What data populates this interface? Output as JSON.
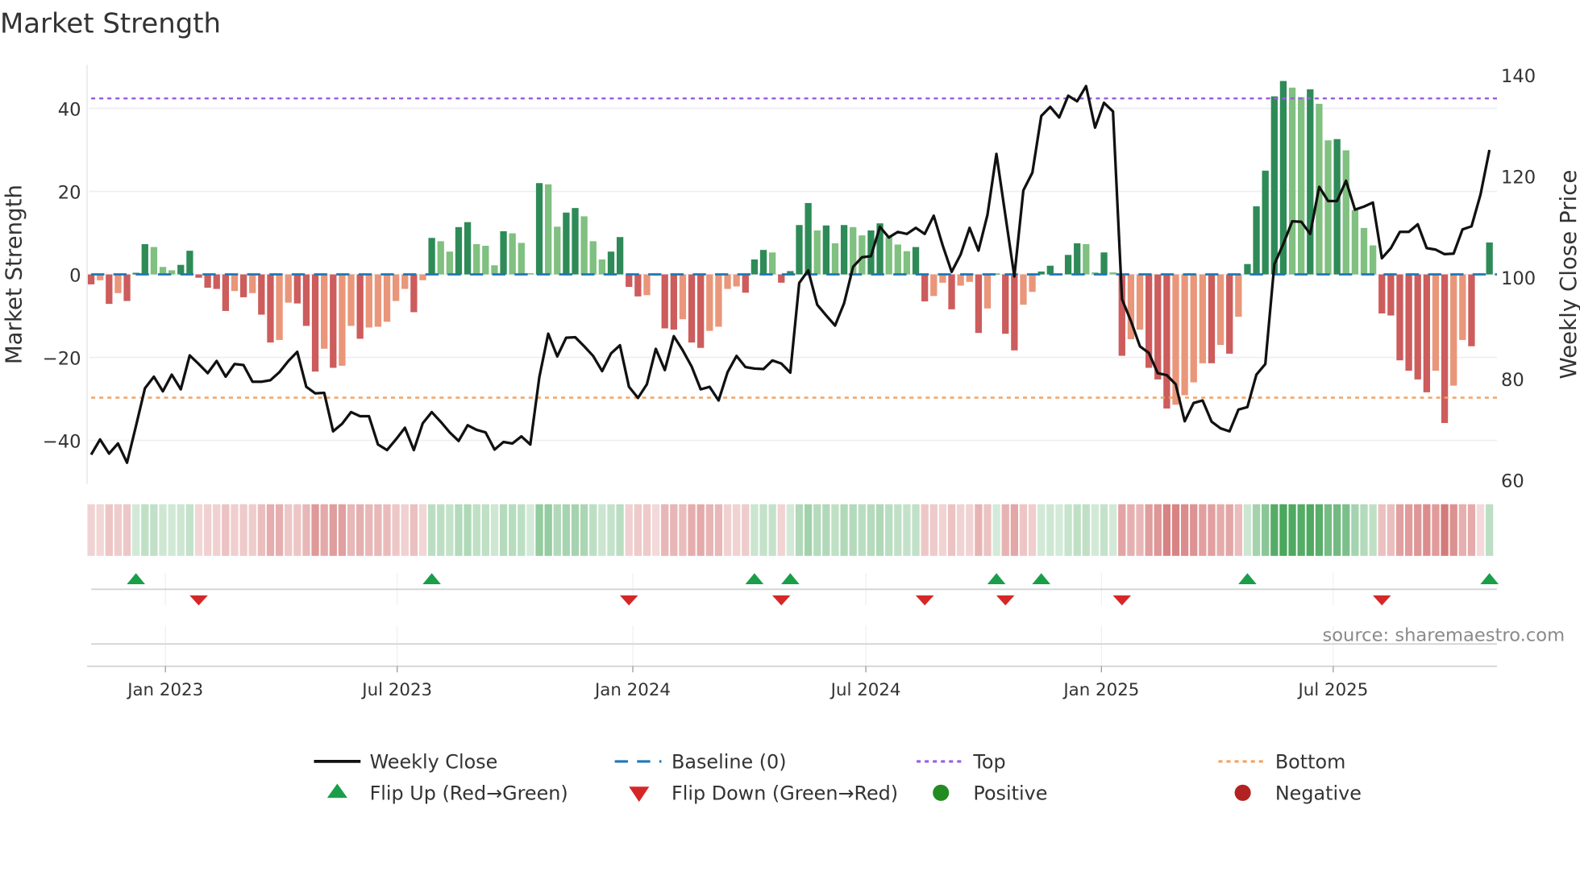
{
  "chart_data": {
    "type": "bar",
    "title": "Market Strength",
    "ylabel": "Market Strength",
    "y2label": "Weekly Close Price",
    "ylim": [
      -50,
      50
    ],
    "y2lim": [
      59.6,
      141.6
    ],
    "yticks": [
      -40,
      -20,
      0,
      20,
      40
    ],
    "ytick_labels": [
      "−40",
      "−20",
      "0",
      "20",
      "40"
    ],
    "y2ticks": [
      60,
      80,
      100,
      120,
      140
    ],
    "y2tick_labels": [
      "60",
      "80",
      "100",
      "120",
      "140"
    ],
    "start_date": "2022-11-04",
    "frequency": "weekly",
    "xticks": [
      {
        "date": "2023-01-01",
        "label": "Jan 2023"
      },
      {
        "date": "2023-07-01",
        "label": "Jul 2023"
      },
      {
        "date": "2024-01-01",
        "label": "Jan 2024"
      },
      {
        "date": "2024-07-01",
        "label": "Jul 2024"
      },
      {
        "date": "2025-01-01",
        "label": "Jan 2025"
      },
      {
        "date": "2025-07-01",
        "label": "Jul 2025"
      }
    ],
    "top_level": 42.4,
    "bottom_level": -29.7,
    "strength": [
      -2.4,
      -1.4,
      -7.1,
      -4.5,
      -6.4,
      0.4,
      7.3,
      6.6,
      1.8,
      1.0,
      2.3,
      5.7,
      -0.8,
      -3.2,
      -3.5,
      -8.8,
      -4.0,
      -5.5,
      -4.5,
      -9.7,
      -16.4,
      -15.8,
      -6.8,
      -7.0,
      -12.4,
      -23.4,
      -17.9,
      -22.5,
      -22.0,
      -12.4,
      -15.5,
      -12.8,
      -12.6,
      -11.4,
      -6.4,
      -3.5,
      -9.1,
      -1.4,
      8.8,
      8.0,
      5.5,
      11.4,
      12.6,
      7.3,
      6.9,
      2.2,
      10.4,
      9.9,
      7.6,
      0.3,
      22.0,
      21.7,
      11.5,
      14.9,
      16.0,
      14.0,
      8.0,
      3.6,
      5.5,
      9.0,
      -3.0,
      -5.3,
      -5.0,
      -0.3,
      -13.0,
      -13.3,
      -10.8,
      -16.4,
      -17.7,
      -13.6,
      -12.6,
      -3.5,
      -2.9,
      -4.4,
      3.6,
      5.9,
      5.3,
      -2.0,
      0.8,
      11.9,
      17.2,
      10.6,
      11.8,
      7.5,
      11.9,
      11.4,
      9.4,
      10.6,
      12.3,
      9.0,
      7.2,
      5.6,
      6.6,
      -6.5,
      -5.2,
      -2.0,
      -8.4,
      -2.7,
      -1.8,
      -14.1,
      -8.2,
      0.2,
      -14.3,
      -18.3,
      -7.3,
      -4.2,
      0.7,
      2.1,
      0.2,
      4.7,
      7.5,
      7.3,
      0.5,
      5.3,
      0.5,
      -19.6,
      -15.6,
      -13.3,
      -22.5,
      -25.3,
      -32.3,
      -31.4,
      -29.1,
      -26.0,
      -21.4,
      -21.4,
      -17.0,
      -19.1,
      -10.2,
      2.5,
      16.4,
      25.0,
      42.9,
      46.6,
      45.0,
      42.7,
      44.6,
      41.1,
      32.3,
      32.6,
      29.9,
      15.5,
      11.2,
      7.0,
      -9.4,
      -9.9,
      -20.7,
      -23.2,
      -25.3,
      -28.4,
      -23.2,
      -35.8,
      -26.8,
      -15.8,
      -17.3,
      -0.2,
      7.7
    ],
    "weekly_close": [
      65,
      68,
      65.2,
      67.2,
      63.4,
      70.7,
      78.1,
      80.4,
      77.5,
      80.8,
      77.9,
      84.6,
      82.9,
      81.1,
      83.5,
      80.4,
      82.9,
      82.7,
      79.4,
      79.4,
      79.7,
      81.3,
      83.5,
      85.3,
      78.4,
      77.1,
      77.2,
      69.6,
      71.1,
      73.4,
      72.6,
      72.6,
      67,
      65.9,
      68,
      70.3,
      65.9,
      71.2,
      73.4,
      71.5,
      69.4,
      67.7,
      70.8,
      69.9,
      69.4,
      66,
      67.5,
      67.2,
      68.6,
      67,
      80.3,
      88.9,
      84.4,
      88.1,
      88.2,
      86.4,
      84.5,
      81.5,
      85,
      86.6,
      78.4,
      76.2,
      78.9,
      85.9,
      81.7,
      88.4,
      85.6,
      82.4,
      77.9,
      78.4,
      75.7,
      81.3,
      84.5,
      82.3,
      82,
      81.9,
      83.6,
      83,
      81.2,
      98.9,
      101.4,
      94.6,
      92.5,
      90.5,
      94.9,
      102.1,
      104,
      104.2,
      110,
      107.9,
      109,
      108.6,
      109.8,
      108.6,
      112.2,
      106.3,
      101.1,
      104.5,
      109.8,
      105.3,
      112.4,
      124.4,
      112.2,
      100.2,
      117.2,
      120.7,
      131.9,
      133.7,
      131.6,
      135.9,
      134.8,
      137.8,
      129.6,
      134.5,
      132.8,
      95.7,
      91.4,
      86.4,
      85.1,
      81.1,
      80.7,
      78.9,
      71.6,
      75.2,
      75.7,
      71.5,
      70.2,
      69.6,
      73.9,
      74.4,
      80.8,
      82.9,
      102.6,
      106.6,
      111.1,
      111,
      108.6,
      117.9,
      115.1,
      115.1,
      119.1,
      113.4,
      114,
      114.8,
      103.8,
      105.8,
      109,
      109,
      110.5,
      105.8,
      105.5,
      104.6,
      104.7,
      109.5,
      110.1,
      116.4,
      125.2
    ],
    "flip_up_weeks": [
      5,
      38,
      74,
      78,
      101,
      106,
      129,
      156
    ],
    "flip_down_weeks": [
      12,
      60,
      77,
      93,
      102,
      115,
      144
    ],
    "legend": {
      "placement": "bottom",
      "items": [
        "Weekly Close",
        "Baseline (0)",
        "Top",
        "Bottom",
        "Flip Up (Red→Green)",
        "Flip Down (Green→Red)",
        "Positive",
        "Negative"
      ]
    },
    "colors": {
      "rising_positive": "#2e8b57",
      "falling_positive": "#80c080",
      "falling_negative": "#cd5c5c",
      "rising_negative": "#e9967a",
      "line": "#111111",
      "baseline": "#1f77b4",
      "top": "#9b5de5",
      "bottom": "#f4a261",
      "flip_up": "#1a9e4a",
      "flip_down": "#d62728",
      "positive": "#228b22",
      "negative": "#b22222"
    }
  },
  "source": "source: sharemaestro.com"
}
